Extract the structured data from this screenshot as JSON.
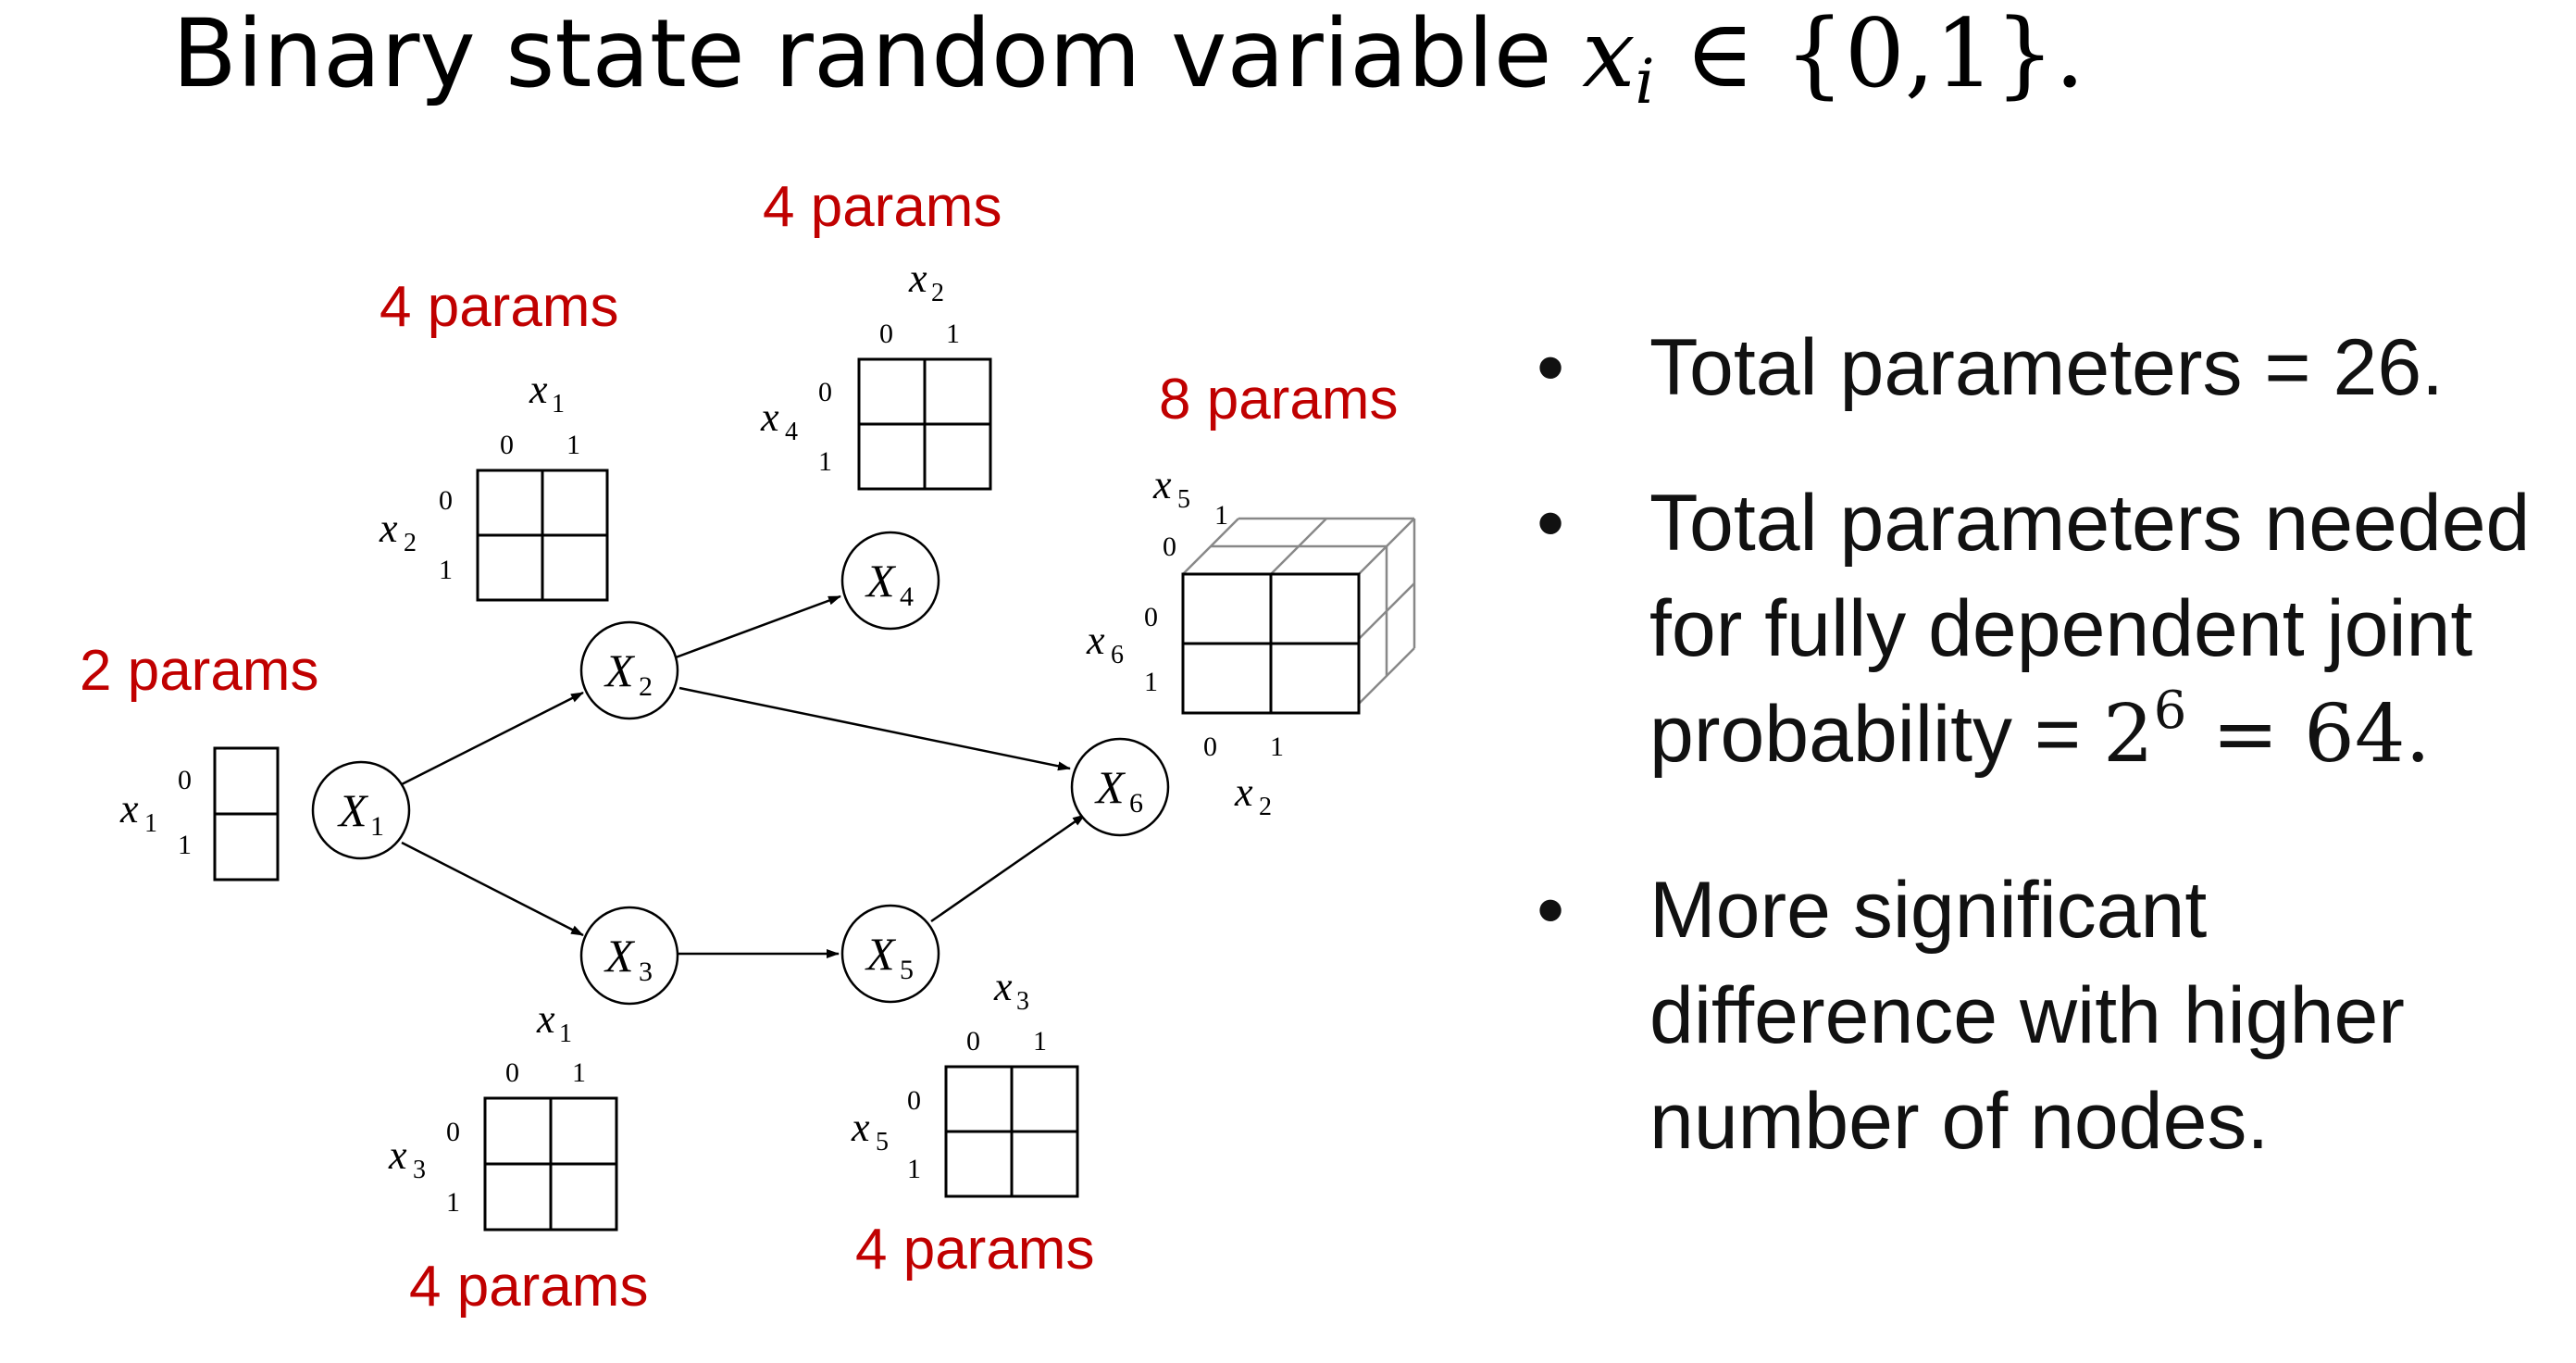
{
  "title": {
    "prefix": "Binary state random variable ",
    "var": "x",
    "sub": "i",
    "rest": " ∈ {0,1}."
  },
  "params": {
    "p1": "2 params",
    "p2": "4 params",
    "p3": "4 params",
    "p4": "4 params",
    "p5": "4 params",
    "p6": "8 params"
  },
  "nodes": {
    "n1": {
      "base": "X",
      "sub": "1"
    },
    "n2": {
      "base": "X",
      "sub": "2"
    },
    "n3": {
      "base": "X",
      "sub": "3"
    },
    "n4": {
      "base": "X",
      "sub": "4"
    },
    "n5": {
      "base": "X",
      "sub": "5"
    },
    "n6": {
      "base": "X",
      "sub": "6"
    }
  },
  "vars": {
    "x": "x",
    "s1": "1",
    "s2": "2",
    "s3": "3",
    "s4": "4",
    "s5": "5",
    "s6": "6",
    "zero": "0",
    "one": "1"
  },
  "bullets": {
    "b1": "Total parameters = 26.",
    "b2_text": "Total parameters needed for fully dependent joint probability = ",
    "b2_base": "2",
    "b2_exp": "6",
    "b2_end": " = 64.",
    "b3": "More significant difference with higher number of nodes.",
    "bullet_char": "•"
  }
}
